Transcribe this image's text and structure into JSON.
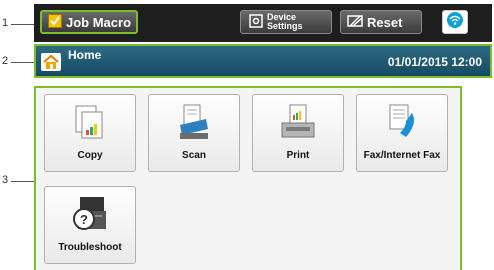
{
  "callouts": [
    "1",
    "2",
    "3"
  ],
  "topbar": {
    "job_macro_label": "Job Macro",
    "device_settings_line1": "Device",
    "device_settings_line2": "Settings",
    "reset_label": "Reset"
  },
  "homebar": {
    "title": "Home",
    "datetime": "01/01/2015 12:00"
  },
  "tiles": [
    {
      "label": "Copy",
      "icon": "copy-icon"
    },
    {
      "label": "Scan",
      "icon": "scan-icon"
    },
    {
      "label": "Print",
      "icon": "print-icon"
    },
    {
      "label": "Fax/Internet Fax",
      "icon": "fax-icon"
    },
    {
      "label": "Troubleshoot",
      "icon": "troubleshoot-icon"
    }
  ],
  "colors": {
    "highlight": "#7cbd2c",
    "homebar": "#1f5a72",
    "topbar": "#1e1e1e",
    "wifi": "#0aa0d8"
  }
}
